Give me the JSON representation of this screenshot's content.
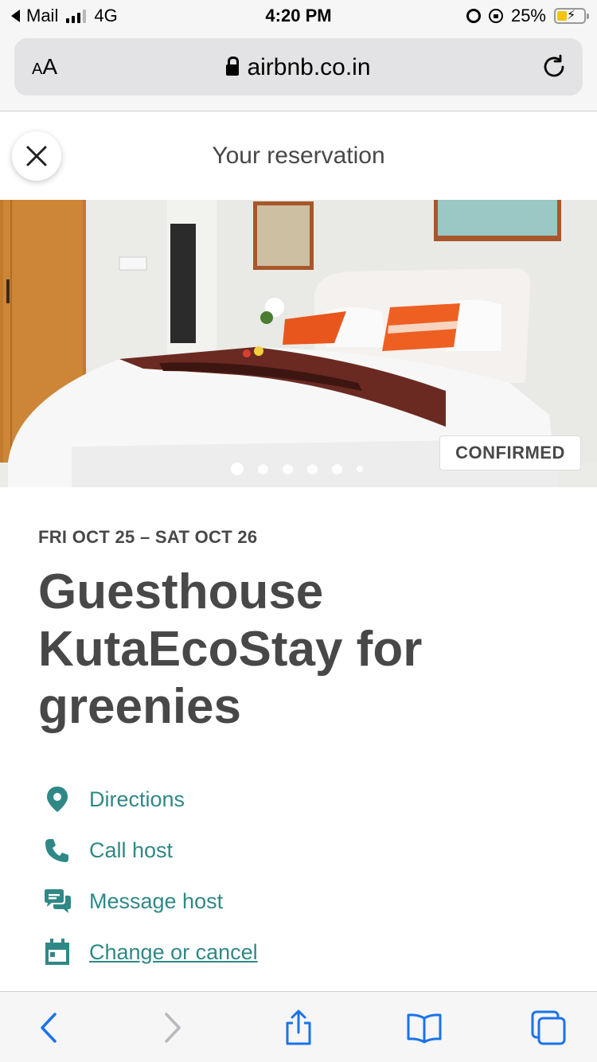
{
  "status_bar": {
    "back_app": "Mail",
    "network": "4G",
    "time": "4:20 PM",
    "battery": "25%"
  },
  "browser": {
    "text_size_label_small": "A",
    "text_size_label_large": "A",
    "url": "airbnb.co.in"
  },
  "reservation": {
    "header_title": "Your reservation",
    "status_badge": "CONFIRMED",
    "photo_count": 6,
    "active_photo_index": 0,
    "dates": "FRI OCT 25 – SAT OCT 26",
    "listing_title": "Guesthouse KutaEcoStay for greenies"
  },
  "actions": [
    {
      "label": "Directions",
      "icon": "location-pin-icon"
    },
    {
      "label": "Call host",
      "icon": "phone-icon"
    },
    {
      "label": "Message host",
      "icon": "chat-bubbles-icon"
    },
    {
      "label": "Change or cancel",
      "icon": "calendar-icon"
    }
  ],
  "colors": {
    "accent_teal": "#2f8886",
    "text_dark": "#484848",
    "ios_blue": "#1a73e8"
  }
}
